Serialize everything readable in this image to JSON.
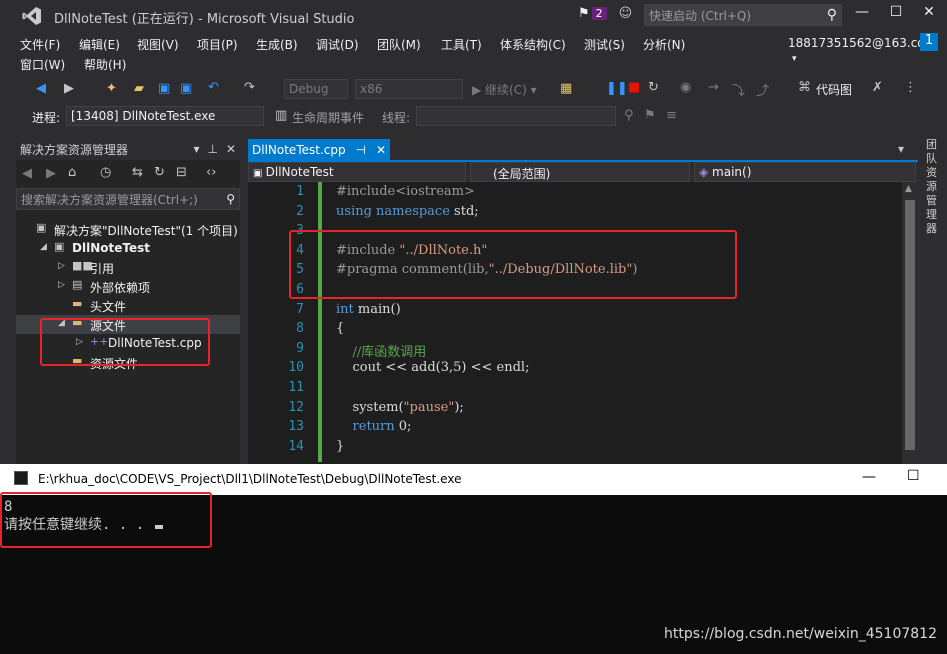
{
  "window": {
    "title": "DllNoteTest (正在运行) - Microsoft Visual Studio",
    "notification_count": "2",
    "quick_launch_placeholder": "快速启动 (Ctrl+Q)",
    "account": "18817351562@163.com",
    "account_badge": "1"
  },
  "menu": {
    "items": [
      "文件(F)",
      "编辑(E)",
      "视图(V)",
      "项目(P)",
      "生成(B)",
      "调试(D)",
      "团队(M)",
      "工具(T)",
      "体系结构(C)",
      "测试(S)",
      "分析(N)"
    ],
    "items_row2": [
      "窗口(W)",
      "帮助(H)"
    ]
  },
  "toolbar": {
    "config": "Debug",
    "platform": "x86",
    "continue_label": "▶ 继续(C) ▾",
    "codemap_label": "代码图",
    "process_label": "进程:",
    "process_value": "[13408] DllNoteTest.exe",
    "lifecycle_label": "生命周期事件",
    "thread_label": "线程:"
  },
  "solution_explorer": {
    "title": "解决方案资源管理器",
    "search_placeholder": "搜索解决方案资源管理器(Ctrl+;)",
    "tree": [
      {
        "label": "解决方案\"DllNoteTest\"(1 个项目)",
        "indent": 0,
        "arrow": "",
        "icon": "▣"
      },
      {
        "label": "DllNoteTest",
        "indent": 1,
        "arrow": "◢",
        "icon": "▣",
        "bold": true
      },
      {
        "label": "引用",
        "indent": 2,
        "arrow": "▷",
        "icon": "■■"
      },
      {
        "label": "外部依赖项",
        "indent": 2,
        "arrow": "▷",
        "icon": "▤"
      },
      {
        "label": "头文件",
        "indent": 2,
        "arrow": "",
        "icon": "▬"
      },
      {
        "label": "源文件",
        "indent": 2,
        "arrow": "◢",
        "icon": "▬",
        "selected": true
      },
      {
        "label": "DllNoteTest.cpp",
        "indent": 3,
        "arrow": "▷",
        "icon": "++"
      },
      {
        "label": "资源文件",
        "indent": 2,
        "arrow": "",
        "icon": "▬"
      }
    ]
  },
  "editor": {
    "tab_name": "DllNoteTest.cpp",
    "nav_project": "DllNoteTest",
    "nav_scope": "(全局范围)",
    "nav_member": "main()",
    "line_numbers": [
      "1",
      "2",
      "3",
      "4",
      "5",
      "6",
      "7",
      "8",
      "9",
      "10",
      "11",
      "12",
      "13",
      "14"
    ],
    "lines": [
      "#include<iostream>",
      "using namespace std;",
      "",
      "#include \"../DllNote.h\"",
      "#pragma comment(lib,\"../Debug/DllNote.lib\")",
      "",
      "int main()",
      "{",
      "    //库函数调用",
      "    cout << add(3,5) << endl;",
      "",
      "    system(\"pause\");",
      "    return 0;",
      "}"
    ]
  },
  "right_panel": {
    "label": "团队资源管理器"
  },
  "console": {
    "title": "E:\\rkhua_doc\\CODE\\VS_Project\\Dll1\\DllNoteTest\\Debug\\DllNoteTest.exe",
    "output_line1": "8",
    "output_line2": "请按任意键继续. . . "
  },
  "watermark": "https://blog.csdn.net/weixin_45107812",
  "colors": {
    "accent": "#007acc",
    "highlight_box": "#e8232a"
  }
}
